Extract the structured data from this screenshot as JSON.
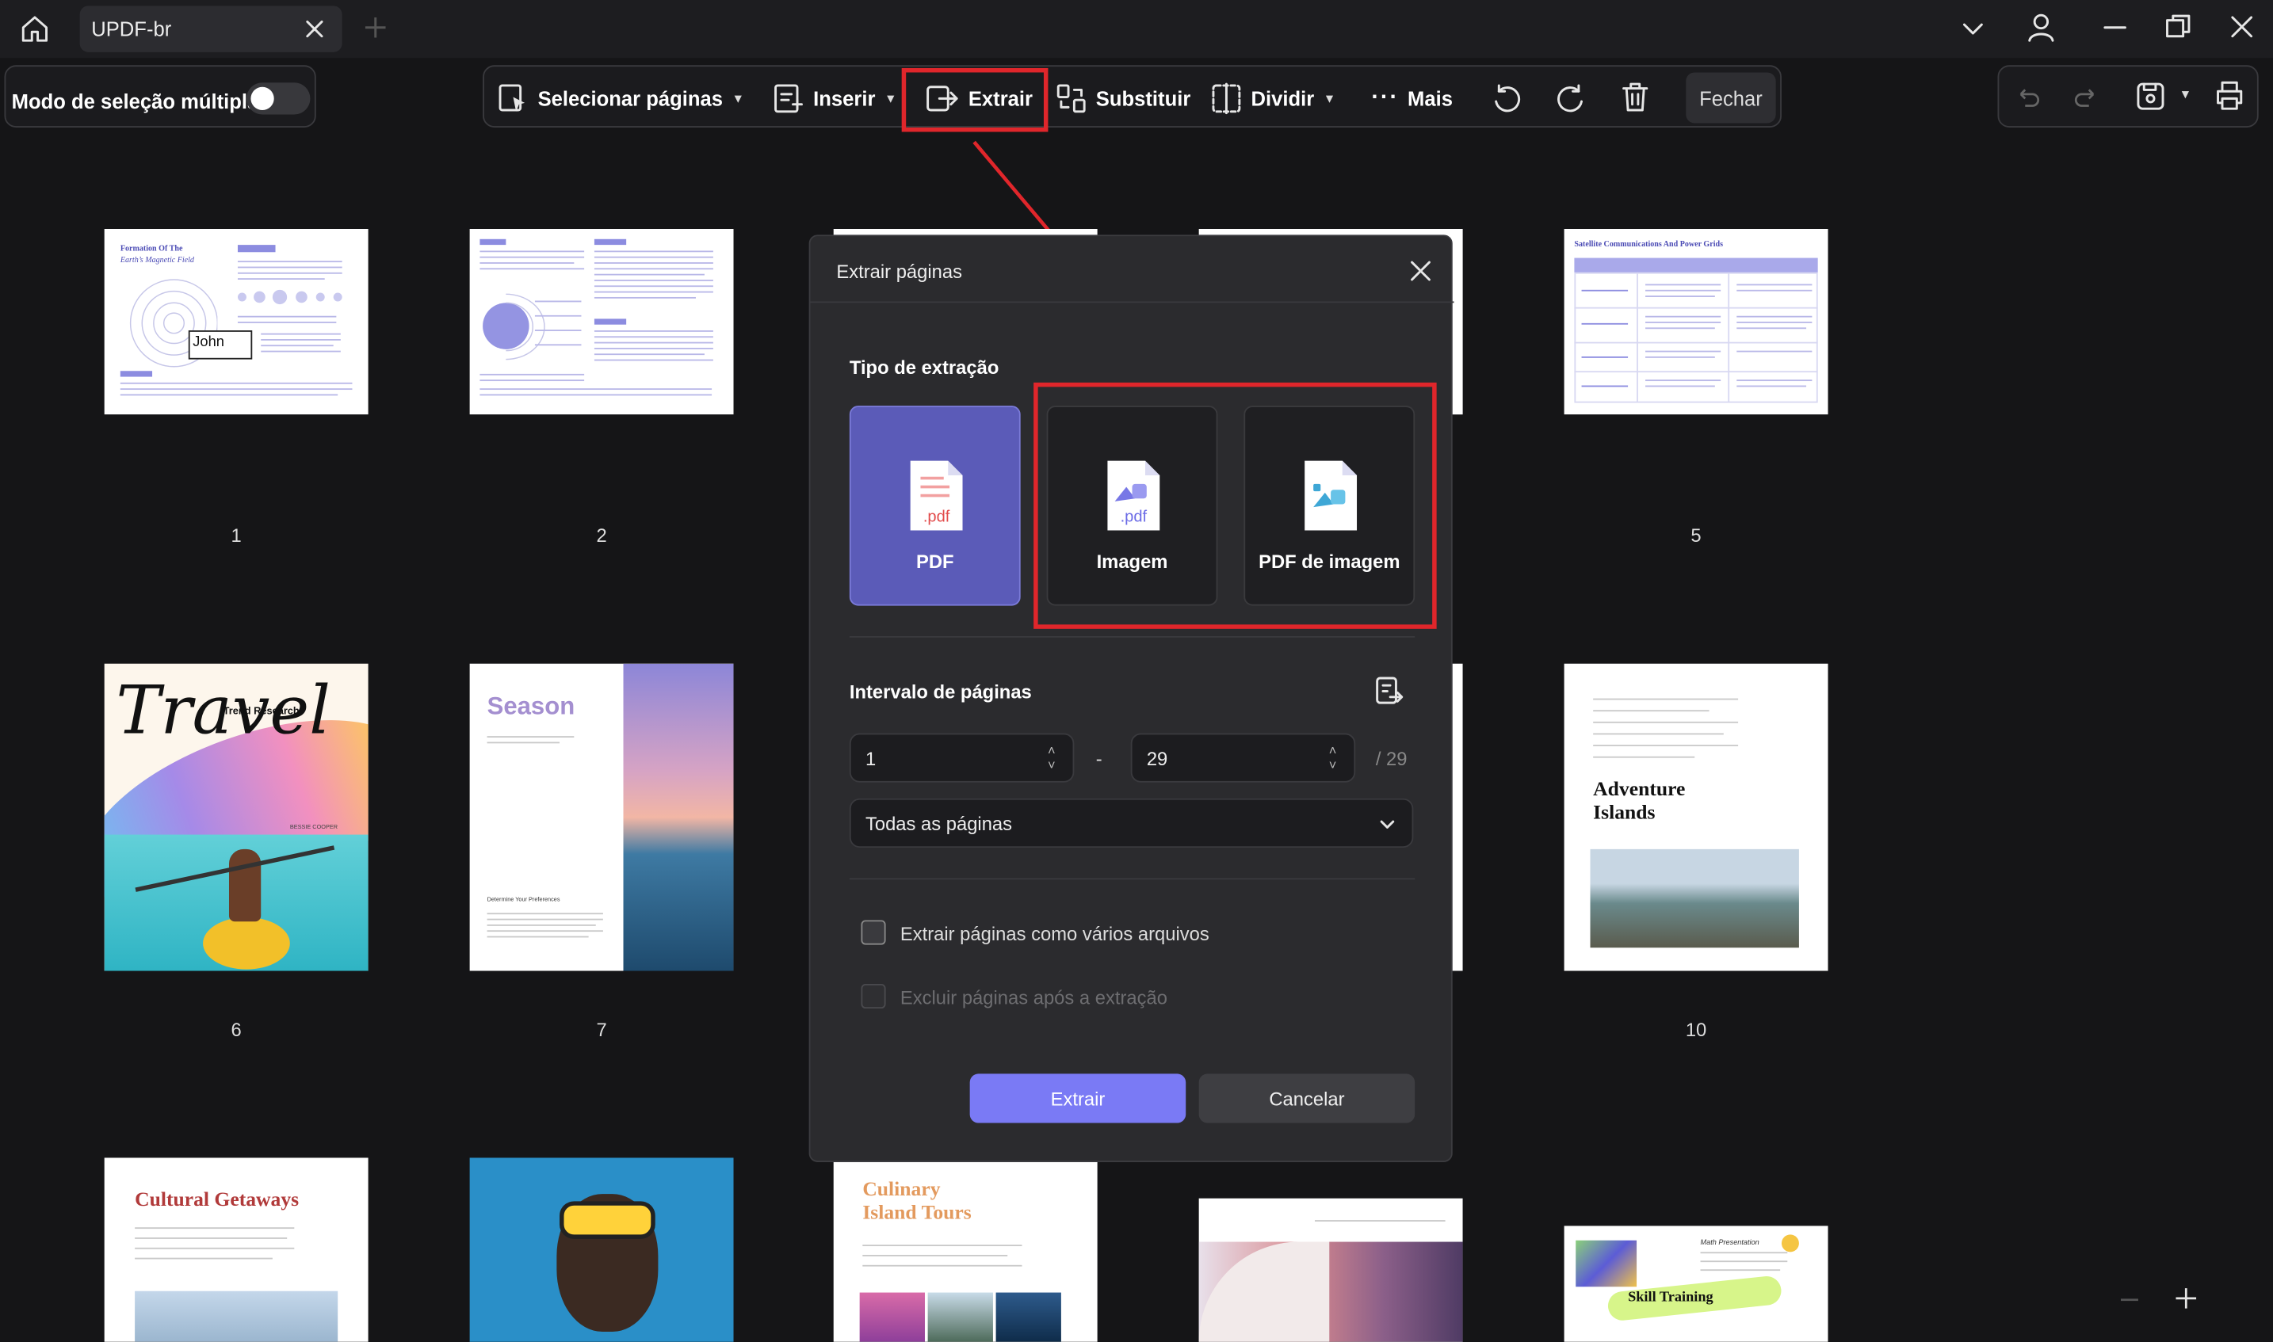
{
  "titlebar": {
    "tab_title": "UPDF-br"
  },
  "toolbar": {
    "multi_select_label": "Modo de seleção múltipla",
    "select_pages": "Selecionar páginas",
    "insert": "Inserir",
    "extract": "Extrair",
    "replace": "Substituir",
    "split": "Dividir",
    "more": "Mais",
    "close": "Fechar"
  },
  "pages": [
    {
      "num": "1"
    },
    {
      "num": "2"
    },
    {
      "num": "5"
    },
    {
      "num": "6"
    },
    {
      "num": "7"
    },
    {
      "num": "10"
    }
  ],
  "thumb_text": {
    "p1_title": "Formation Of The",
    "p1_title2": "Earth’s Magnetic Field",
    "p1_name": "John",
    "p5_title": "Satellite Communications And Power Grids",
    "p6_travel": "Travel",
    "p6_trend": "Trend Research",
    "p6_author": "BESSIE COOPER",
    "p7_title": "Season",
    "p7_sub": "Determine Your Preferences",
    "p10_title": "Adventure",
    "p10_title2": "Islands",
    "p11_title": "Cultural Getaways",
    "p13_title": "Culinary",
    "p13_title2": "Island Tours",
    "p15_title": "Skill Training",
    "p15_sub": "Math Presentation"
  },
  "dialog": {
    "title": "Extrair páginas",
    "extraction_type_label": "Tipo de extração",
    "options": [
      {
        "label": "PDF",
        "icon_text": ".pdf",
        "selected": true
      },
      {
        "label": "Imagem",
        "icon_text": ".pdf",
        "selected": false
      },
      {
        "label": "PDF de imagem",
        "icon_text": "",
        "selected": false
      }
    ],
    "page_range_label": "Intervalo de páginas",
    "from_value": "1",
    "dash": "-",
    "to_value": "29",
    "total_pages": "/ 29",
    "range_select": "Todas as páginas",
    "checkbox_multiple_files": "Extrair páginas como vários arquivos",
    "checkbox_delete_after": "Excluir páginas após a extração",
    "extract_button": "Extrair",
    "cancel_button": "Cancelar"
  },
  "colors": {
    "accent": "#7a7af5",
    "selected_card": "#5b5bb8",
    "highlight_red": "#e0262b"
  }
}
